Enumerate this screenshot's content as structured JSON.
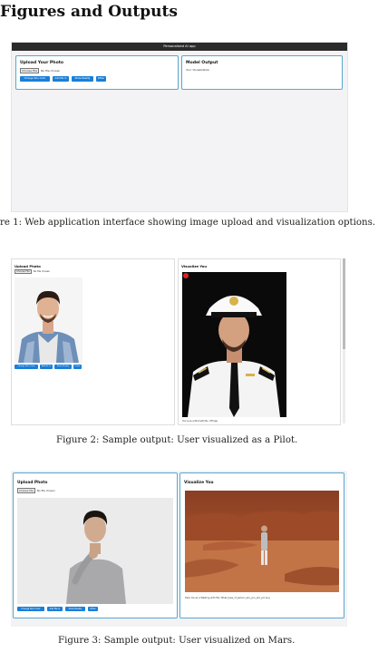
{
  "section_title": "Figures and Outputs",
  "figure1": {
    "caption": "re 1: Web application interface showing image upload and visualization options.",
    "app_title": "Personalized AI app",
    "upload_title": "Upload Your Photo",
    "choose_file": "Choose File",
    "no_file": "No file chosen",
    "buttons": [
      "Change Skin Color",
      "Add Me In",
      "Show Reality",
      "Other"
    ],
    "output_title": "Model Output",
    "output_text": "Your Visualization"
  },
  "figure2": {
    "caption": "Figure 2: Sample output: User visualized as a Pilot.",
    "upload_title": "Upload Photo",
    "choose_file": "Choose File",
    "no_file": "No file chosen",
    "buttons": [
      "Change Skin Color",
      "Add Me In",
      "Show Reality",
      "Other"
    ],
    "visualize_title": "Visualize You",
    "output_text": "You're as a Pilot with No. Off App"
  },
  "figure3": {
    "caption": "Figure 3: Sample output: User visualized on Mars.",
    "upload_title": "Upload Photo",
    "choose_file": "Choose File",
    "no_file": "No file chosen",
    "buttons": [
      "Change Skin Color",
      "Add Me In",
      "Show Reality",
      "Other"
    ],
    "visualize_title": "Visualize You",
    "output_text": "Here me as a Walking with file: What_type_of_person_are_you_ipic_pic.png"
  },
  "colors": {
    "accent": "#1a7fd8",
    "card_border": "#5aa7cc",
    "appbar": "#2b2b2b",
    "panel_bg": "#f3f3f5"
  }
}
